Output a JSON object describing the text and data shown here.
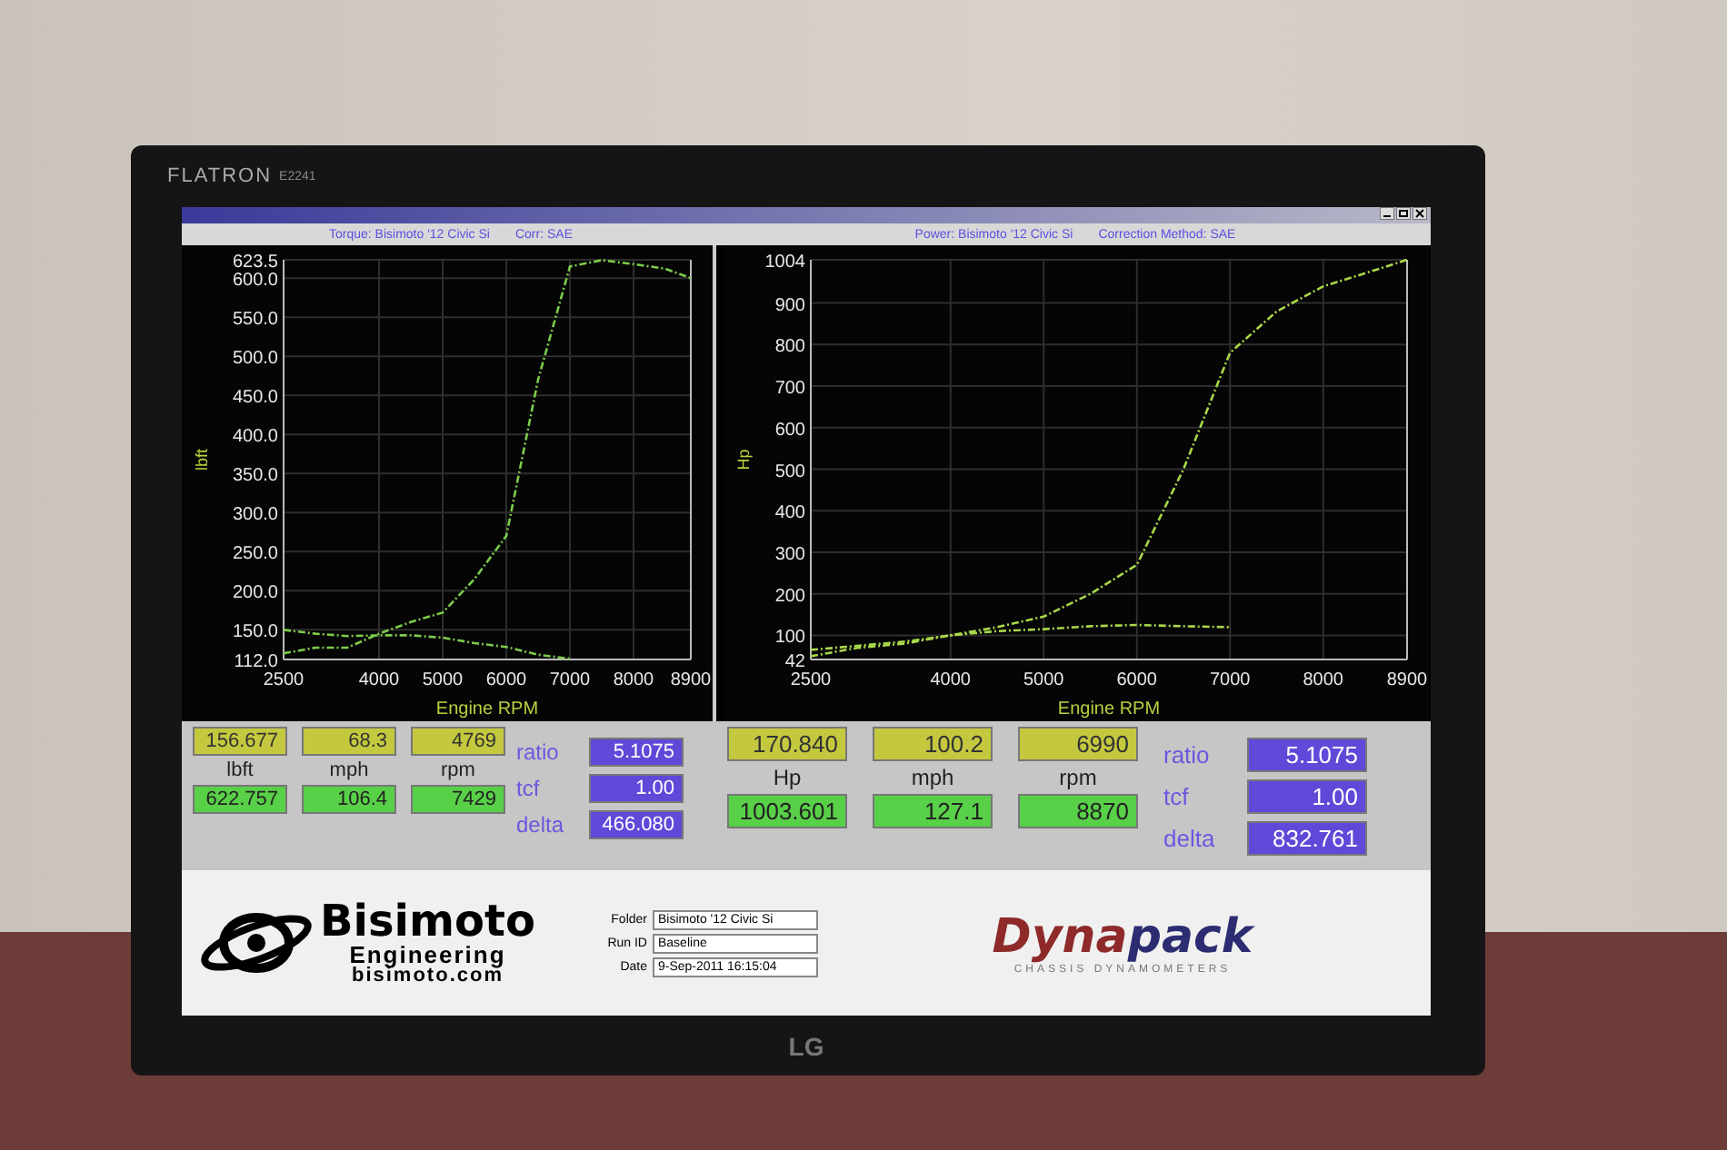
{
  "monitor": {
    "brand": "FLATRON",
    "model": "E2241",
    "logo": "LG"
  },
  "torque_panel": {
    "title": "Torque: Bisimoto '12 Civic Si",
    "correction": "Corr: SAE",
    "chart_data": {
      "type": "line",
      "xlabel": "Engine RPM",
      "ylabel": "lbft",
      "x": [
        2500,
        3000,
        3500,
        4000,
        4500,
        5000,
        5500,
        6000,
        6500,
        7000,
        7500,
        8000,
        8500,
        8900
      ],
      "series": [
        {
          "color": "#7ccc4a",
          "line_style": "dashed",
          "values": [
            120,
            127,
            127,
            145,
            160,
            172,
            215,
            270,
            470,
            615,
            623,
            618,
            612,
            600
          ]
        },
        {
          "color": "#7ccc4a",
          "line_style": "dashed",
          "values": [
            150,
            145,
            142,
            143,
            143,
            140,
            133,
            128,
            118,
            113,
            null,
            null,
            null,
            null
          ]
        }
      ],
      "xlim": [
        2500,
        8900
      ],
      "ylim": [
        112,
        623.5
      ],
      "grid": true,
      "xticks": [
        2500,
        4000,
        5000,
        6000,
        7000,
        8000,
        8900
      ],
      "yticks": [
        {
          "value": 112,
          "label": "112.0"
        },
        {
          "value": 150,
          "label": "150.0"
        },
        {
          "value": 200,
          "label": "200.0"
        },
        {
          "value": 250,
          "label": "250.0"
        },
        {
          "value": 300,
          "label": "300.0"
        },
        {
          "value": 350,
          "label": "350.0"
        },
        {
          "value": 400,
          "label": "400.0"
        },
        {
          "value": 450,
          "label": "450.0"
        },
        {
          "value": 500,
          "label": "500.0"
        },
        {
          "value": 550,
          "label": "550.0"
        },
        {
          "value": 600,
          "label": "600.0"
        },
        {
          "value": 623.5,
          "label": "623.5"
        }
      ]
    },
    "readouts": [
      {
        "label": "lbft",
        "current": "156.677",
        "peak": "622.757"
      },
      {
        "label": "mph",
        "current": "68.3",
        "peak": "106.4"
      },
      {
        "label": "rpm",
        "current": "4769",
        "peak": "7429"
      }
    ],
    "factors": [
      {
        "label": "ratio",
        "value": "5.1075"
      },
      {
        "label": "tcf",
        "value": "1.00"
      },
      {
        "label": "delta",
        "value": "466.080"
      }
    ]
  },
  "power_panel": {
    "title": "Power: Bisimoto '12 Civic Si",
    "correction": "Correction Method: SAE",
    "chart_data": {
      "type": "line",
      "xlabel": "Engine RPM",
      "ylabel": "Hp",
      "x": [
        2500,
        3000,
        3500,
        4000,
        4500,
        5000,
        5500,
        6000,
        6500,
        7000,
        7500,
        8000,
        8500,
        8900
      ],
      "series": [
        {
          "color": "#a8d84a",
          "line_style": "dashed",
          "values": [
            50,
            70,
            80,
            100,
            120,
            145,
            200,
            270,
            500,
            780,
            880,
            940,
            975,
            1004
          ]
        },
        {
          "color": "#a8d84a",
          "line_style": "dashed",
          "values": [
            65,
            75,
            85,
            100,
            110,
            115,
            122,
            125,
            122,
            120,
            null,
            null,
            null,
            null
          ]
        }
      ],
      "xlim": [
        2500,
        8900
      ],
      "ylim": [
        42,
        1004
      ],
      "grid": true,
      "xticks": [
        2500,
        4000,
        5000,
        6000,
        7000,
        8000,
        8900
      ],
      "yticks": [
        42,
        100,
        200,
        300,
        400,
        500,
        600,
        700,
        800,
        900,
        1004
      ]
    },
    "readouts": [
      {
        "label": "Hp",
        "current": "170.840",
        "peak": "1003.601"
      },
      {
        "label": "mph",
        "current": "100.2",
        "peak": "127.1"
      },
      {
        "label": "rpm",
        "current": "6990",
        "peak": "8870"
      }
    ],
    "factors": [
      {
        "label": "ratio",
        "value": "5.1075"
      },
      {
        "label": "tcf",
        "value": "1.00"
      },
      {
        "label": "delta",
        "value": "832.761"
      }
    ]
  },
  "tuner_logo": {
    "name": "Bisimoto",
    "subtitle": "Engineering",
    "website": "bisimoto.com"
  },
  "run_info": [
    {
      "label": "Folder",
      "value": "Bisimoto '12 Civic Si"
    },
    {
      "label": "Run ID",
      "value": "Baseline"
    },
    {
      "label": "Date",
      "value": "9-Sep-2011 16:15:04"
    }
  ],
  "dyno_logo": {
    "name_part_1": "Dyna",
    "name_part_2": "pack",
    "tagline": "CHASSIS DYNAMOMETERS"
  }
}
